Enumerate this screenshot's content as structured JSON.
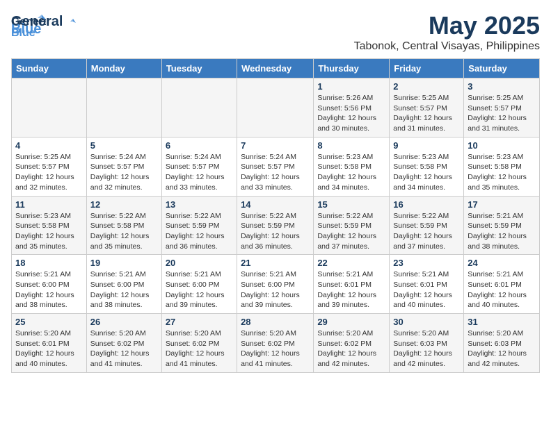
{
  "header": {
    "logo_general": "General",
    "logo_blue": "Blue",
    "month_year": "May 2025",
    "location": "Tabonok, Central Visayas, Philippines"
  },
  "days_of_week": [
    "Sunday",
    "Monday",
    "Tuesday",
    "Wednesday",
    "Thursday",
    "Friday",
    "Saturday"
  ],
  "weeks": [
    [
      {
        "day": "",
        "info": ""
      },
      {
        "day": "",
        "info": ""
      },
      {
        "day": "",
        "info": ""
      },
      {
        "day": "",
        "info": ""
      },
      {
        "day": "1",
        "info": "Sunrise: 5:26 AM\nSunset: 5:56 PM\nDaylight: 12 hours\nand 30 minutes."
      },
      {
        "day": "2",
        "info": "Sunrise: 5:25 AM\nSunset: 5:57 PM\nDaylight: 12 hours\nand 31 minutes."
      },
      {
        "day": "3",
        "info": "Sunrise: 5:25 AM\nSunset: 5:57 PM\nDaylight: 12 hours\nand 31 minutes."
      }
    ],
    [
      {
        "day": "4",
        "info": "Sunrise: 5:25 AM\nSunset: 5:57 PM\nDaylight: 12 hours\nand 32 minutes."
      },
      {
        "day": "5",
        "info": "Sunrise: 5:24 AM\nSunset: 5:57 PM\nDaylight: 12 hours\nand 32 minutes."
      },
      {
        "day": "6",
        "info": "Sunrise: 5:24 AM\nSunset: 5:57 PM\nDaylight: 12 hours\nand 33 minutes."
      },
      {
        "day": "7",
        "info": "Sunrise: 5:24 AM\nSunset: 5:57 PM\nDaylight: 12 hours\nand 33 minutes."
      },
      {
        "day": "8",
        "info": "Sunrise: 5:23 AM\nSunset: 5:58 PM\nDaylight: 12 hours\nand 34 minutes."
      },
      {
        "day": "9",
        "info": "Sunrise: 5:23 AM\nSunset: 5:58 PM\nDaylight: 12 hours\nand 34 minutes."
      },
      {
        "day": "10",
        "info": "Sunrise: 5:23 AM\nSunset: 5:58 PM\nDaylight: 12 hours\nand 35 minutes."
      }
    ],
    [
      {
        "day": "11",
        "info": "Sunrise: 5:23 AM\nSunset: 5:58 PM\nDaylight: 12 hours\nand 35 minutes."
      },
      {
        "day": "12",
        "info": "Sunrise: 5:22 AM\nSunset: 5:58 PM\nDaylight: 12 hours\nand 35 minutes."
      },
      {
        "day": "13",
        "info": "Sunrise: 5:22 AM\nSunset: 5:59 PM\nDaylight: 12 hours\nand 36 minutes."
      },
      {
        "day": "14",
        "info": "Sunrise: 5:22 AM\nSunset: 5:59 PM\nDaylight: 12 hours\nand 36 minutes."
      },
      {
        "day": "15",
        "info": "Sunrise: 5:22 AM\nSunset: 5:59 PM\nDaylight: 12 hours\nand 37 minutes."
      },
      {
        "day": "16",
        "info": "Sunrise: 5:22 AM\nSunset: 5:59 PM\nDaylight: 12 hours\nand 37 minutes."
      },
      {
        "day": "17",
        "info": "Sunrise: 5:21 AM\nSunset: 5:59 PM\nDaylight: 12 hours\nand 38 minutes."
      }
    ],
    [
      {
        "day": "18",
        "info": "Sunrise: 5:21 AM\nSunset: 6:00 PM\nDaylight: 12 hours\nand 38 minutes."
      },
      {
        "day": "19",
        "info": "Sunrise: 5:21 AM\nSunset: 6:00 PM\nDaylight: 12 hours\nand 38 minutes."
      },
      {
        "day": "20",
        "info": "Sunrise: 5:21 AM\nSunset: 6:00 PM\nDaylight: 12 hours\nand 39 minutes."
      },
      {
        "day": "21",
        "info": "Sunrise: 5:21 AM\nSunset: 6:00 PM\nDaylight: 12 hours\nand 39 minutes."
      },
      {
        "day": "22",
        "info": "Sunrise: 5:21 AM\nSunset: 6:01 PM\nDaylight: 12 hours\nand 39 minutes."
      },
      {
        "day": "23",
        "info": "Sunrise: 5:21 AM\nSunset: 6:01 PM\nDaylight: 12 hours\nand 40 minutes."
      },
      {
        "day": "24",
        "info": "Sunrise: 5:21 AM\nSunset: 6:01 PM\nDaylight: 12 hours\nand 40 minutes."
      }
    ],
    [
      {
        "day": "25",
        "info": "Sunrise: 5:20 AM\nSunset: 6:01 PM\nDaylight: 12 hours\nand 40 minutes."
      },
      {
        "day": "26",
        "info": "Sunrise: 5:20 AM\nSunset: 6:02 PM\nDaylight: 12 hours\nand 41 minutes."
      },
      {
        "day": "27",
        "info": "Sunrise: 5:20 AM\nSunset: 6:02 PM\nDaylight: 12 hours\nand 41 minutes."
      },
      {
        "day": "28",
        "info": "Sunrise: 5:20 AM\nSunset: 6:02 PM\nDaylight: 12 hours\nand 41 minutes."
      },
      {
        "day": "29",
        "info": "Sunrise: 5:20 AM\nSunset: 6:02 PM\nDaylight: 12 hours\nand 42 minutes."
      },
      {
        "day": "30",
        "info": "Sunrise: 5:20 AM\nSunset: 6:03 PM\nDaylight: 12 hours\nand 42 minutes."
      },
      {
        "day": "31",
        "info": "Sunrise: 5:20 AM\nSunset: 6:03 PM\nDaylight: 12 hours\nand 42 minutes."
      }
    ]
  ]
}
